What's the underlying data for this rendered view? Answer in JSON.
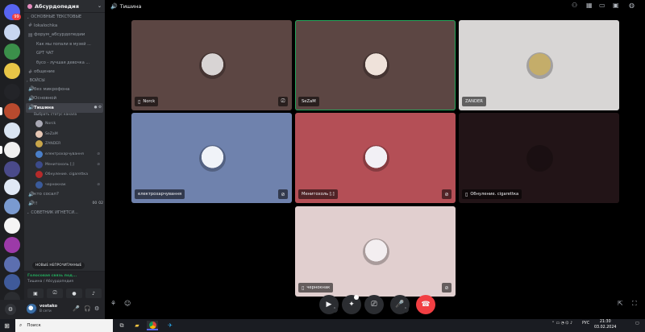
{
  "app": {
    "name": "Discord"
  },
  "server_rail": {
    "notification_badge": "99",
    "servers": [
      {
        "name": "home",
        "color": "#5865f2"
      },
      {
        "name": "server-2",
        "color": "#c8d6f0"
      },
      {
        "name": "server-3",
        "color": "#3b8f4a"
      },
      {
        "name": "server-4",
        "color": "#e8c547"
      },
      {
        "name": "server-5",
        "color": "#232428"
      },
      {
        "name": "server-6",
        "color": "#b84a2e"
      },
      {
        "name": "server-7",
        "color": "#d9e4f2"
      },
      {
        "name": "server-8",
        "color": "#f0f0f0"
      },
      {
        "name": "server-9",
        "color": "#4a4a8a"
      },
      {
        "name": "server-10",
        "color": "#e0e8f5"
      },
      {
        "name": "server-11",
        "color": "#7a9ad0"
      },
      {
        "name": "server-12",
        "color": "#f5f5f5"
      },
      {
        "name": "server-13",
        "color": "#9c3aa8"
      },
      {
        "name": "server-14",
        "color": "#5c6fb0"
      },
      {
        "name": "server-15",
        "color": "#3f5a9a"
      },
      {
        "name": "server-16",
        "color": "#2b2d31"
      }
    ]
  },
  "guild": {
    "name": "Абсурдопедия"
  },
  "categories": {
    "text": "ОСНОВНЫЕ ТЕКСТОВЫЕ",
    "voice": "ВОЙСЫ",
    "unread": "СОВЕТНИК ИГНЕТСИ..."
  },
  "text_channels": [
    {
      "name": "lokalochka",
      "sym": "#"
    },
    {
      "name": "форум_абсурдопедии",
      "sym": "▤"
    }
  ],
  "forum_threads": [
    {
      "name": "Как мы попали в музей ..."
    },
    {
      "name": "GPT ЧАТ"
    },
    {
      "name": "бусо - лучшая девочка ..."
    }
  ],
  "text_channels_2": [
    {
      "name": "общение",
      "sym": "#"
    }
  ],
  "voice_channels": [
    {
      "name": "без микрофона",
      "sym": "🔊"
    },
    {
      "name": "Основной",
      "sym": "🔊"
    }
  ],
  "active_channel": {
    "name": "Тишина",
    "status_placeholder": "Выбрать статус канала"
  },
  "voice_users": [
    {
      "name": "Norck",
      "color": "#a9a9b5"
    },
    {
      "name": "SeZaM",
      "color": "#e6c7b5"
    },
    {
      "name": "ZANDER",
      "color": "#c9a64a"
    },
    {
      "name": "електрохарчування",
      "color": "#4a7fc9"
    },
    {
      "name": "Менитохоль [;]",
      "color": "#3b4a8a"
    },
    {
      "name": "Обнуление. cigarettка",
      "color": "#b52a2a"
    },
    {
      "name": "чернокнак",
      "color": "#3a5a9a"
    }
  ],
  "other_channels": [
    {
      "name": "кто сосал?",
      "sym": "🔊"
    },
    {
      "name": "!!",
      "sym": "🔊",
      "count": "00",
      "count2": "02"
    }
  ],
  "new_unread_label": "НОВЫЕ НЕПРОЧИТАННЫЕ",
  "voice_panel": {
    "status": "Голосовая связь под...",
    "location": "Тишина / Абсурдопедия"
  },
  "user_panel": {
    "name": "vostako",
    "status": "В сети"
  },
  "stage": {
    "channel_title": "Тишина",
    "tiles": [
      {
        "name": "Norck",
        "bg": "#5c4643",
        "av": "#d8d4d4",
        "device": "phone",
        "muted": false,
        "speaking": false,
        "right_icon": "stream"
      },
      {
        "name": "SeZaM",
        "bg": "#5c4643",
        "av": "#efe2da",
        "device": "",
        "muted": false,
        "speaking": true,
        "right_icon": ""
      },
      {
        "name": "ZANDER",
        "bg": "#d8d6d5",
        "av": "#c4ad6a",
        "device": "",
        "muted": false,
        "speaking": false,
        "right_icon": ""
      },
      {
        "name": "електрохарчування",
        "bg": "#6f82ad",
        "av": "#f0f3f8",
        "device": "",
        "muted": true,
        "speaking": false,
        "right_icon": "mute"
      },
      {
        "name": "Менитохоль [;]",
        "bg": "#b44f56",
        "av": "#f2f0f5",
        "device": "",
        "muted": true,
        "speaking": false,
        "right_icon": "deafen"
      },
      {
        "name": "Обнуление. cigarettка",
        "bg": "#221417",
        "av": "#1a0f12",
        "device": "phone",
        "muted": false,
        "speaking": false,
        "right_icon": ""
      },
      {
        "name": "чернокнак",
        "bg": "#e1cfcf",
        "av": "#f3eef0",
        "device": "phone",
        "muted": true,
        "speaking": false,
        "right_icon": "mute"
      }
    ]
  },
  "taskbar": {
    "search_placeholder": "Поиск",
    "tray_lang": "РУС",
    "time": "21:30",
    "date": "03.02.2024"
  }
}
